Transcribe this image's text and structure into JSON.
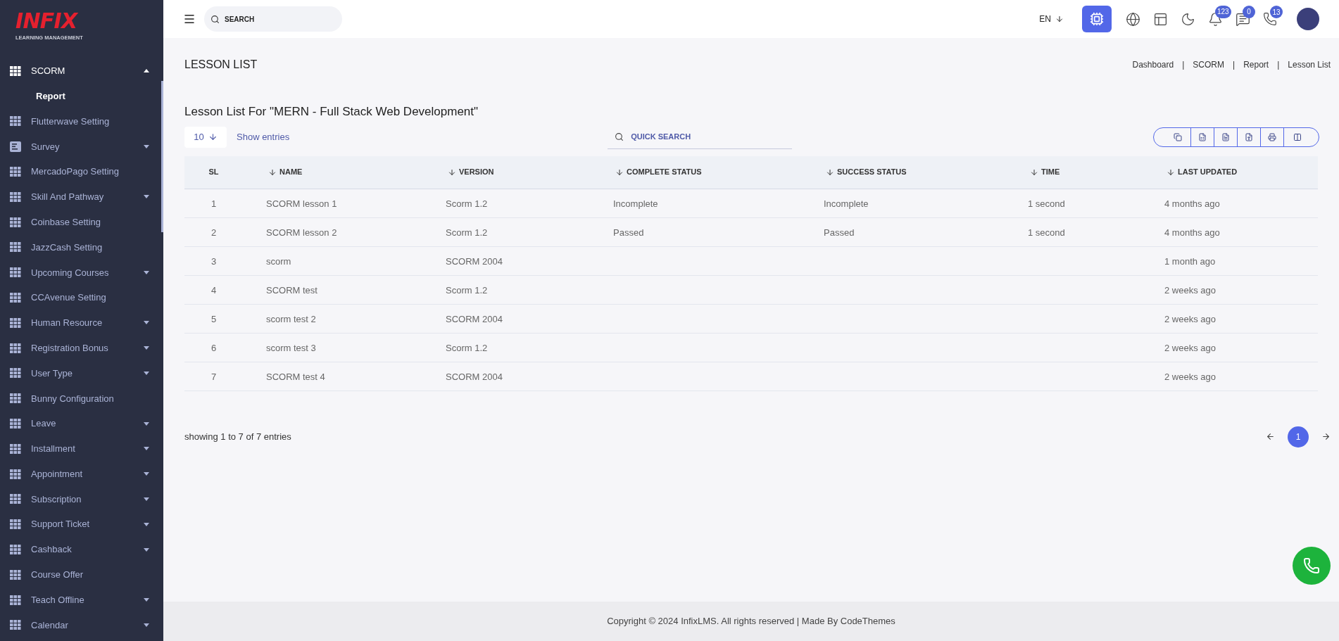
{
  "logo": {
    "brand": "INFIX",
    "tagline": "LEARNING MANAGEMENT"
  },
  "sidebar": {
    "items": [
      {
        "label": "SCORM",
        "kind": "group",
        "expanded": true,
        "selected": true,
        "children": [
          {
            "label": "Report",
            "selected": true
          }
        ]
      },
      {
        "label": "Flutterwave Setting",
        "kind": "page",
        "expanded": false,
        "selected": false
      },
      {
        "label": "Survey",
        "kind": "form-group",
        "expanded": false,
        "selected": false
      },
      {
        "label": "MercadoPago Setting",
        "kind": "page",
        "expanded": false,
        "selected": false
      },
      {
        "label": "Skill And Pathway",
        "kind": "group",
        "expanded": false,
        "selected": false
      },
      {
        "label": "Coinbase Setting",
        "kind": "page",
        "expanded": false,
        "selected": false
      },
      {
        "label": "JazzCash Setting",
        "kind": "page",
        "expanded": false,
        "selected": false
      },
      {
        "label": "Upcoming Courses",
        "kind": "group",
        "expanded": false,
        "selected": false
      },
      {
        "label": "CCAvenue Setting",
        "kind": "page",
        "expanded": false,
        "selected": false
      },
      {
        "label": "Human Resource",
        "kind": "group",
        "expanded": false,
        "selected": false
      },
      {
        "label": "Registration Bonus",
        "kind": "group",
        "expanded": false,
        "selected": false
      },
      {
        "label": "User Type",
        "kind": "group",
        "expanded": false,
        "selected": false
      },
      {
        "label": "Bunny Configuration",
        "kind": "page",
        "expanded": false,
        "selected": false
      },
      {
        "label": "Leave",
        "kind": "group",
        "expanded": false,
        "selected": false
      },
      {
        "label": "Installment",
        "kind": "group",
        "expanded": false,
        "selected": false
      },
      {
        "label": "Appointment",
        "kind": "group",
        "expanded": false,
        "selected": false
      },
      {
        "label": "Subscription",
        "kind": "group",
        "expanded": false,
        "selected": false
      },
      {
        "label": "Support Ticket",
        "kind": "group",
        "expanded": false,
        "selected": false
      },
      {
        "label": "Cashback",
        "kind": "group",
        "expanded": false,
        "selected": false
      },
      {
        "label": "Course Offer",
        "kind": "page",
        "expanded": false,
        "selected": false
      },
      {
        "label": "Teach Offline",
        "kind": "group",
        "expanded": false,
        "selected": false
      },
      {
        "label": "Calendar",
        "kind": "group",
        "expanded": false,
        "selected": false
      }
    ]
  },
  "topbar": {
    "search": {
      "placeholder": "SEARCH"
    },
    "language": "EN",
    "badges": {
      "notifications": "123",
      "messages": "0",
      "chats": "13"
    }
  },
  "page": {
    "title": "LESSON LIST",
    "breadcrumb": [
      "Dashboard",
      "SCORM",
      "Report",
      "Lesson List"
    ],
    "breadcrumb_separator": "|"
  },
  "card": {
    "title": "Lesson List For \"MERN - Full Stack Web Development\"",
    "page_size": "10",
    "show_entries": "Show entries",
    "quick_search": {
      "placeholder": "QUICK SEARCH"
    }
  },
  "table": {
    "columns": [
      {
        "label": "SL",
        "sortable": false
      },
      {
        "label": "NAME",
        "sortable": true
      },
      {
        "label": "VERSION",
        "sortable": true
      },
      {
        "label": "COMPLETE STATUS",
        "sortable": true
      },
      {
        "label": "SUCCESS STATUS",
        "sortable": true
      },
      {
        "label": "TIME",
        "sortable": true
      },
      {
        "label": "LAST UPDATED",
        "sortable": true
      }
    ],
    "rows": [
      {
        "cells": [
          "1",
          "SCORM lesson 1",
          "Scorm 1.2",
          "Incomplete",
          "Incomplete",
          "1 second",
          "4 months ago"
        ]
      },
      {
        "cells": [
          "2",
          "SCORM lesson 2",
          "Scorm 1.2",
          "Passed",
          "Passed",
          "1 second",
          "4 months ago"
        ]
      },
      {
        "cells": [
          "3",
          "scorm",
          "SCORM 2004",
          "",
          "",
          "",
          "1 month ago"
        ]
      },
      {
        "cells": [
          "4",
          "SCORM test",
          "Scorm 1.2",
          "",
          "",
          "",
          "2 weeks ago"
        ]
      },
      {
        "cells": [
          "5",
          "scorm test 2",
          "SCORM 2004",
          "",
          "",
          "",
          "2 weeks ago"
        ]
      },
      {
        "cells": [
          "6",
          "scorm test 3",
          "Scorm 1.2",
          "",
          "",
          "",
          "2 weeks ago"
        ]
      },
      {
        "cells": [
          "7",
          "SCORM test 4",
          "SCORM 2004",
          "",
          "",
          "",
          "2 weeks ago"
        ]
      }
    ]
  },
  "pagination": {
    "summary": "showing 1 to 7 of 7 entries",
    "pages": [
      {
        "label": "1",
        "selected": true
      }
    ]
  },
  "footer": "Copyright © 2024 InfixLMS. All rights reserved | Made By CodeThemes"
}
